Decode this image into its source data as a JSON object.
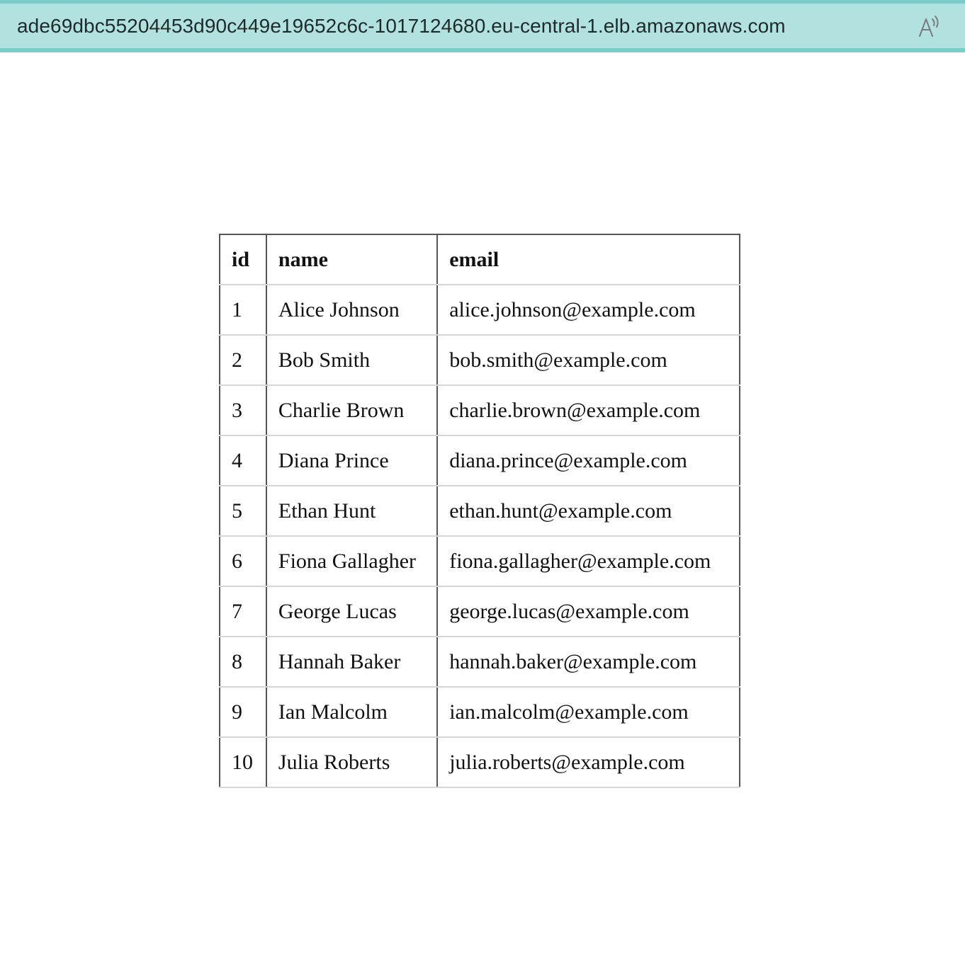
{
  "browser": {
    "url": "ade69dbc55204453d90c449e19652c6c-1017124680.eu-central-1.elb.amazonaws.com",
    "read_aloud_icon": "read-aloud-icon"
  },
  "table": {
    "headers": {
      "id": "id",
      "name": "name",
      "email": "email"
    },
    "rows": [
      {
        "id": "1",
        "name": "Alice Johnson",
        "email": "alice.johnson@example.com"
      },
      {
        "id": "2",
        "name": "Bob Smith",
        "email": "bob.smith@example.com"
      },
      {
        "id": "3",
        "name": "Charlie Brown",
        "email": "charlie.brown@example.com"
      },
      {
        "id": "4",
        "name": "Diana Prince",
        "email": "diana.prince@example.com"
      },
      {
        "id": "5",
        "name": "Ethan Hunt",
        "email": "ethan.hunt@example.com"
      },
      {
        "id": "6",
        "name": "Fiona Gallagher",
        "email": "fiona.gallagher@example.com"
      },
      {
        "id": "7",
        "name": "George Lucas",
        "email": "george.lucas@example.com"
      },
      {
        "id": "8",
        "name": "Hannah Baker",
        "email": "hannah.baker@example.com"
      },
      {
        "id": "9",
        "name": "Ian Malcolm",
        "email": "ian.malcolm@example.com"
      },
      {
        "id": "10",
        "name": "Julia Roberts",
        "email": "julia.roberts@example.com"
      }
    ]
  },
  "colors": {
    "address_bar_bg": "#b2e2e0",
    "address_bar_border": "#7dcbc7",
    "table_border": "#555555",
    "row_divider": "#d6d6d6"
  }
}
